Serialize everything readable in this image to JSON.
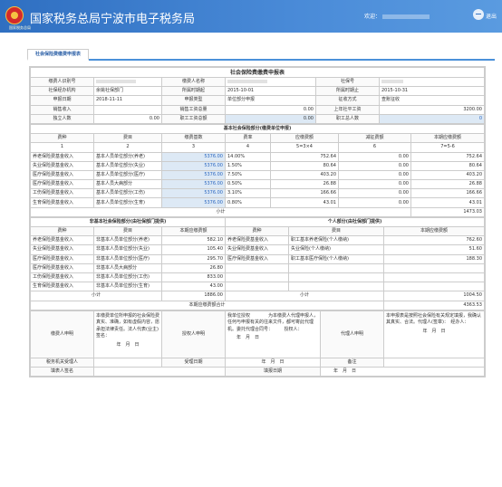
{
  "header": {
    "title": "国家税务总局宁波市电子税务局",
    "brand": "国家税务总局",
    "welcome": "欢迎：",
    "logout": "退出"
  },
  "tab": "社会保险费缴费申报表",
  "form": {
    "title": "社会保险费缴费申报表",
    "r1": [
      "缴费人识别号",
      "缴费人名称",
      "社保号"
    ],
    "r2": {
      "l1": "社保经办机构",
      "v1": "余姚社保部门",
      "l2": "所属时期起",
      "v2": "2015-10-01",
      "l3": "所属时期止",
      "v3": "2015-10-31"
    },
    "r3": {
      "l1": "申报日期",
      "v1": "2018-11-11",
      "l2": "申报类型",
      "v2": "单位部分申报",
      "l3": "征收方式",
      "v3": "查账征收"
    },
    "r4": {
      "l1": "销售收入",
      "l2": "销售工资总量",
      "v2": "0.00",
      "l3": "上年社平工资",
      "v3": "3200.00"
    },
    "r5": {
      "l1": "独立人数",
      "v1": "0.00",
      "l2": "职工工资总额",
      "v2": "0.00",
      "l3": "职工总人数",
      "v3": "0"
    },
    "basic": {
      "title": "基本社会保险部分(缴费单位申报)",
      "headers": [
        "费种",
        "费目",
        "缴费基数",
        "费率",
        "应缴费额",
        "减征费额",
        "本期应缴费额"
      ],
      "nums": [
        "1",
        "2",
        "3",
        "4",
        "5=3×4",
        "6",
        "7=5-6"
      ],
      "rows": [
        [
          "养老保险费基金收入",
          "基本人员单位部分(养老)",
          "5376.00",
          "14.00%",
          "752.64",
          "0.00",
          "752.64"
        ],
        [
          "失业保险费基金收入",
          "基本人员单位部分(失业)",
          "5376.00",
          "1.50%",
          "80.64",
          "0.00",
          "80.64"
        ],
        [
          "医疗保险费基金收入",
          "基本人员单位部分(医疗)",
          "5376.00",
          "7.50%",
          "403.20",
          "0.00",
          "403.20"
        ],
        [
          "医疗保险费基金收入",
          "基本人员大病部分",
          "5376.00",
          "0.50%",
          "26.88",
          "0.00",
          "26.88"
        ],
        [
          "工伤保险费基金收入",
          "基本人员单位部分(工伤)",
          "5376.00",
          "3.10%",
          "166.66",
          "0.00",
          "166.66"
        ],
        [
          "生育保险费基金收入",
          "基本人员单位部分(生育)",
          "5376.00",
          "0.80%",
          "43.01",
          "0.00",
          "43.01"
        ]
      ],
      "subtotal_label": "小计",
      "subtotal": "1473.03"
    },
    "non": {
      "title_left": "非基本社会保险部分(由社保部门提供)",
      "title_right": "个人部分(由社保部门提供)",
      "headers": [
        "费种",
        "费目",
        "本期应缴费额",
        "费种",
        "费目",
        "本期应缴费额"
      ],
      "rows": [
        [
          "养老保险费基金收入",
          "非基本人员单位部分(养老)",
          "582.10",
          "养老保险费基金收入",
          "职工基本养老保险(个人缴纳)",
          "762.60"
        ],
        [
          "失业保险费基金收入",
          "非基本人员单位部分(失业)",
          "105.40",
          "失业保险费基金收入",
          "失业保险(个人缴纳)",
          "51.60"
        ],
        [
          "医疗保险费基金收入",
          "非基本人员单位部分(医疗)",
          "295.70",
          "医疗保险费基金收入",
          "职工基本医疗保险(个人缴纳)",
          "188.30"
        ],
        [
          "医疗保险费基金收入",
          "非基本人员大病部分",
          "26.80",
          "",
          "",
          ""
        ],
        [
          "工伤保险费基金收入",
          "非基本人员单位部分(工伤)",
          "833.00",
          "",
          "",
          ""
        ],
        [
          "生育保险费基金收入",
          "非基本人员单位部分(生育)",
          "43.00",
          "",
          "",
          ""
        ]
      ],
      "subtotal_label": "小计",
      "subtotal_left": "1886.00",
      "subtotal_right": "1004.50"
    },
    "total_label": "本期应缴费额合计",
    "total": "4363.53",
    "decl": {
      "l1": "缴费人申明",
      "t1": "本缴费单位所申报的社会保险费真实、准确，如有虚假内容，愿承担法律责任。法人代表(业主)签名：",
      "d1": "年　月　日",
      "l2": "授权人申明",
      "t2": "我单位授权　　　　为本缴费人代理申报人，任何与申报有关的往来文件，都可寄此代理机。委托代理合同号：　　　授权人：",
      "d2": "年　月　日",
      "l3": "代理人申明",
      "t3": "本申报表是按照社会保险有关规定填报，我确认其真实、合法。代理人(签章)：　经办人：",
      "d3": "年　月　日"
    },
    "foot1": {
      "l1": "税务机关受理人",
      "l2": "受理日期",
      "v2": "年　月　日",
      "l3": "备注"
    },
    "foot2": {
      "l1": "填表人签名",
      "l2": "填报日期",
      "v2": "年　月　日"
    }
  }
}
